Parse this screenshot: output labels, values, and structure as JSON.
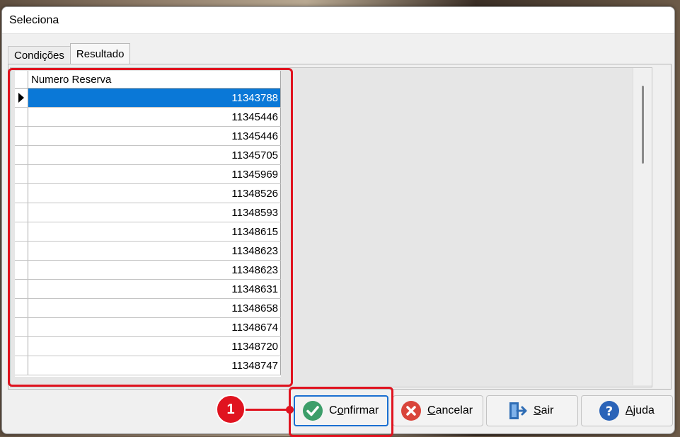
{
  "window": {
    "title": "Seleciona"
  },
  "tabs": [
    {
      "label": "Condições",
      "active": false
    },
    {
      "label": "Resultado",
      "active": true
    }
  ],
  "grid": {
    "column_header": "Numero Reserva",
    "rows": [
      "11343788",
      "11345446",
      "11345446",
      "11345705",
      "11345969",
      "11348526",
      "11348593",
      "11348615",
      "11348623",
      "11348623",
      "11348631",
      "11348658",
      "11348674",
      "11348720",
      "11348747"
    ],
    "selected_index": 0
  },
  "buttons": {
    "confirm": {
      "prefix": "C",
      "underlined": "o",
      "rest": "nfirmar",
      "icon": "check-icon"
    },
    "cancel": {
      "prefix": "",
      "underlined": "C",
      "rest": "ancelar",
      "icon": "close-icon"
    },
    "exit": {
      "prefix": "",
      "underlined": "S",
      "rest": "air",
      "icon": "exit-door-icon"
    },
    "help": {
      "prefix": "",
      "underlined": "A",
      "rest": "juda",
      "icon": "help-icon"
    }
  },
  "annotation": {
    "number": "1"
  },
  "colors": {
    "highlight": "#e0131f",
    "selection": "#0a78d7"
  }
}
